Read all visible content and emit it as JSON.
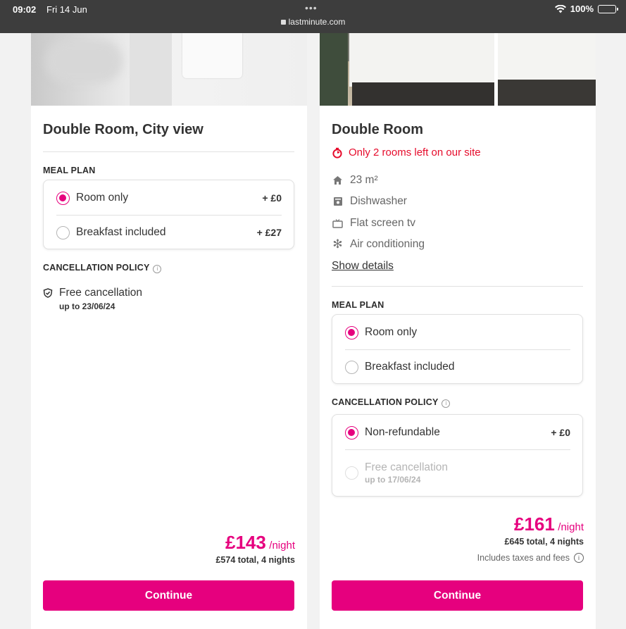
{
  "status_bar": {
    "time": "09:02",
    "date": "Fri 14 Jun",
    "url": "lastminute.com",
    "battery": "100%",
    "icons": [
      "wifi-icon",
      "battery-icon",
      "lock-icon"
    ]
  },
  "colors": {
    "accent": "#e6007e",
    "urgent": "#e60b2b"
  },
  "left_card": {
    "title": "Double Room, City view",
    "meal_plan_label": "MEAL PLAN",
    "meal_options": [
      {
        "label": "Room only",
        "price": "+ £0",
        "selected": true
      },
      {
        "label": "Breakfast included",
        "price": "+ £27",
        "selected": false
      }
    ],
    "cancellation_label": "CANCELLATION POLICY",
    "cancellation": {
      "title": "Free cancellation",
      "sub": "up to 23/06/24"
    },
    "price": "£143",
    "per_night": "/night",
    "total": "£574 total, 4 nights",
    "continue_label": "Continue"
  },
  "right_card": {
    "title": "Double Room",
    "urgency": "Only 2 rooms left on our site",
    "amenities": [
      {
        "icon": "home-icon",
        "label": "23 m²"
      },
      {
        "icon": "dishwasher-icon",
        "label": "Dishwasher"
      },
      {
        "icon": "tv-icon",
        "label": "Flat screen tv"
      },
      {
        "icon": "snowflake-icon",
        "label": "Air conditioning"
      }
    ],
    "show_details": "Show details",
    "meal_plan_label": "MEAL PLAN",
    "meal_options": [
      {
        "label": "Room only",
        "selected": true
      },
      {
        "label": "Breakfast included",
        "selected": false
      }
    ],
    "cancellation_label": "CANCELLATION POLICY",
    "cancel_options": [
      {
        "label": "Non-refundable",
        "price": "+ £0",
        "selected": true,
        "disabled": false
      },
      {
        "label": "Free cancellation",
        "sub": "up to 17/06/24",
        "selected": false,
        "disabled": true
      }
    ],
    "price": "£161",
    "per_night": "/night",
    "total": "£645 total, 4 nights",
    "taxes": "Includes taxes and fees",
    "continue_label": "Continue"
  }
}
